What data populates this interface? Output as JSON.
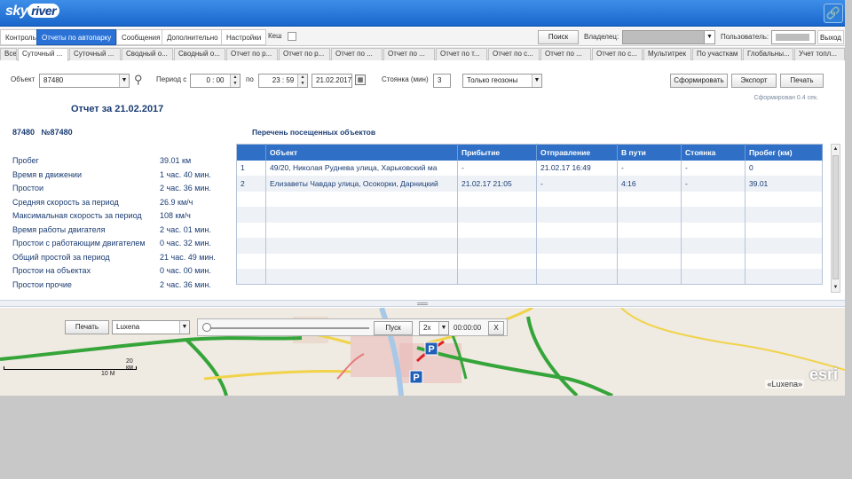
{
  "header": {
    "logo_a": "sky",
    "logo_b": "river"
  },
  "menu": {
    "items": [
      {
        "label": "Контроль"
      },
      {
        "label": "Отчеты по автопарку",
        "active": true
      },
      {
        "label": "Сообщения"
      },
      {
        "label": "Дополнительно"
      },
      {
        "label": "Настройки"
      }
    ],
    "cache_label": "Кеш",
    "search_label": "Поиск",
    "owner_label": "Владелец:",
    "user_label": "Пользователь:",
    "exit_label": "Выход"
  },
  "tabs": [
    "Все",
    "Суточный ...",
    "Суточный ...",
    "Сводный о...",
    "Сводный о...",
    "Отчет по р...",
    "Отчет по р...",
    "Отчет по ...",
    "Отчет по ...",
    "Отчет по т...",
    "Отчет по с...",
    "Отчет по ...",
    "Отчет по с...",
    "Мультитрек",
    "По участкам",
    "Глобальны...",
    "Учет топл..."
  ],
  "toolbar": {
    "object_label": "Объект",
    "object_value": "87480",
    "period_label": "Период с",
    "from_h": "0",
    "from_m": "00",
    "to_label": "по",
    "to_h": "23",
    "to_m": "59",
    "date": "21.02.2017",
    "stop_label": "Стоянка (мин)",
    "stop_value": "3",
    "geozone_value": "Только геозоны",
    "generate_label": "Сформировать",
    "export_label": "Экспорт",
    "print_label": "Печать",
    "generated_note": "Сформирован 0.4 сек."
  },
  "report": {
    "title": "Отчет за 21.02.2017",
    "unit": "87480   №87480",
    "stats": [
      {
        "label": "Пробег",
        "value": "39.01 км"
      },
      {
        "label": "Время в движении",
        "value": "1 час. 40 мин."
      },
      {
        "label": "Простои",
        "value": "2 час. 36 мин."
      },
      {
        "label": "Средняя скорость за период",
        "value": "26.9 км/ч"
      },
      {
        "label": "Максимальная скорость за период",
        "value": "108 км/ч"
      },
      {
        "label": "Время работы двигателя",
        "value": "2 час. 01 мин."
      },
      {
        "label": "Простои с работающим двигателем",
        "value": "0 час. 32 мин."
      },
      {
        "label": "Общий простой за период",
        "value": "21 час. 49 мин."
      },
      {
        "label": "Простои на объектах",
        "value": "0 час. 00 мин."
      },
      {
        "label": "Простои прочие",
        "value": "2 час. 36 мин."
      }
    ],
    "list_title": "Перечень посещенных объектов",
    "columns": [
      "",
      "Объект",
      "Прибытие",
      "Отправление",
      "В пути",
      "Стоянка",
      "Пробег (км)"
    ],
    "rows": [
      [
        "1",
        "49/20, Николая Руднева улица, Харьковский ма",
        "-",
        "21.02.17 16:49",
        "-",
        "-",
        "0"
      ],
      [
        "2",
        "Елизаветы Чавдар улица, Осокорки, Дарницкий",
        "21.02.17 21:05",
        "-",
        "4:16",
        "-",
        "39.01"
      ],
      [
        "",
        "",
        "",
        "",
        "",
        "",
        ""
      ],
      [
        "",
        "",
        "",
        "",
        "",
        "",
        ""
      ],
      [
        "",
        "",
        "",
        "",
        "",
        "",
        ""
      ],
      [
        "",
        "",
        "",
        "",
        "",
        "",
        ""
      ],
      [
        "",
        "",
        "",
        "",
        "",
        "",
        ""
      ],
      [
        "",
        "",
        "",
        "",
        "",
        "",
        ""
      ]
    ]
  },
  "map": {
    "print_label": "Печать",
    "layer_value": "Luxena",
    "play_label": "Пуск",
    "speed_value": "2x",
    "time_value": "00:00:00",
    "close_label": "X",
    "scale_km": "20 км",
    "scale_mi": "10 М",
    "esri": "esri",
    "copyright": "«Luxena»",
    "colors": {
      "road_green": "#35a53a",
      "road_yellow": "#f1d34a",
      "city_pink": "#e9b8b8",
      "water": "#a8c8e8"
    }
  }
}
